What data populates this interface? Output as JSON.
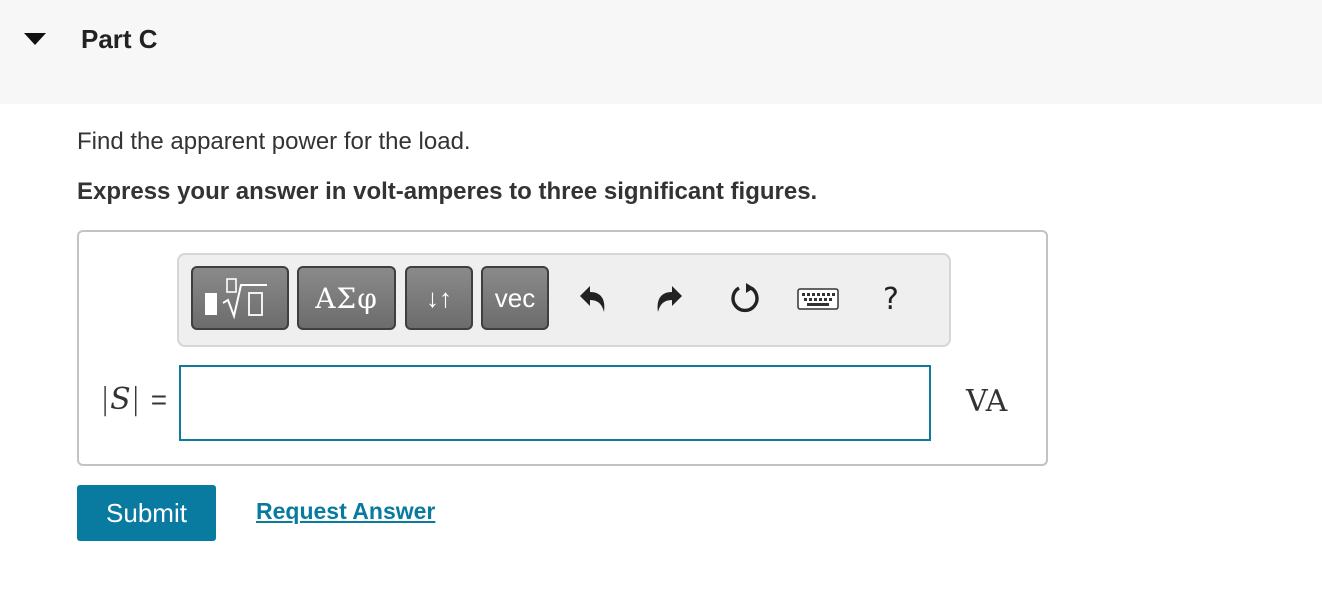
{
  "part": {
    "title": "Part C",
    "expanded": true
  },
  "question": {
    "prompt": "Find the apparent power for the load.",
    "instruction": "Express your answer in volt-amperes to three significant figures."
  },
  "toolbar": {
    "templates_icon": "templates-radical-icon",
    "greek_label": "ΑΣφ",
    "arrows_label": "↓↑",
    "vec_label": "vec",
    "undo_icon": "undo-icon",
    "redo_icon": "redo-icon",
    "reset_icon": "reset-icon",
    "keyboard_icon": "keyboard-icon",
    "help_label": "?"
  },
  "answer": {
    "bar_left": "|",
    "variable": "S",
    "bar_right": "|",
    "equals": "=",
    "value": "",
    "unit": "VA"
  },
  "actions": {
    "submit_label": "Submit",
    "request_label": "Request Answer"
  },
  "colors": {
    "accent": "#0a7ba0",
    "input_border": "#0f7a9b",
    "header_bg": "#f7f7f7",
    "toolbar_button": "#7a7a7a"
  }
}
